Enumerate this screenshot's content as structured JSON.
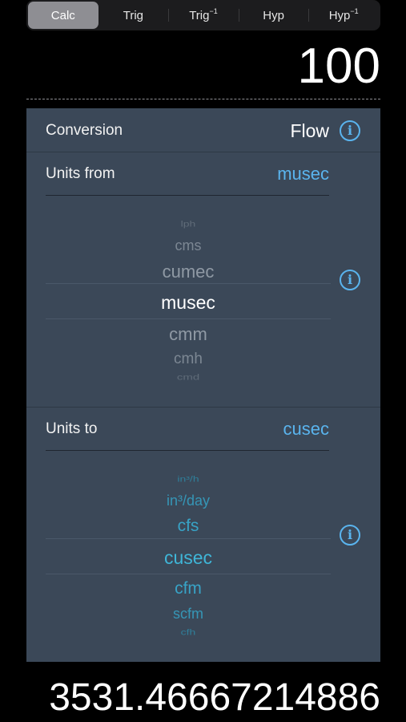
{
  "segments": [
    {
      "label": "Calc",
      "active": true
    },
    {
      "label": "Trig",
      "active": false
    },
    {
      "label": "Trig",
      "sup": "−1",
      "active": false
    },
    {
      "label": "Hyp",
      "active": false
    },
    {
      "label": "Hyp",
      "sup": "−1",
      "active": false
    }
  ],
  "input_value": "100",
  "conversion": {
    "label": "Conversion",
    "value": "Flow"
  },
  "units_from": {
    "label": "Units from",
    "value": "musec",
    "picker": [
      "lph",
      "cms",
      "cumec",
      "musec",
      "cmm",
      "cmh",
      "cmd"
    ],
    "selected_index": 3
  },
  "units_to": {
    "label": "Units to",
    "value": "cusec",
    "picker": [
      "in³/h",
      "in³/day",
      "cfs",
      "cusec",
      "cfm",
      "scfm",
      "cfh"
    ],
    "selected_index": 3
  },
  "result_value": "3531.46667214886",
  "icons": {
    "info": "i"
  },
  "colors": {
    "accent": "#5ab4ee",
    "panel": "#3b4858",
    "teal": "#3fb6d8"
  }
}
